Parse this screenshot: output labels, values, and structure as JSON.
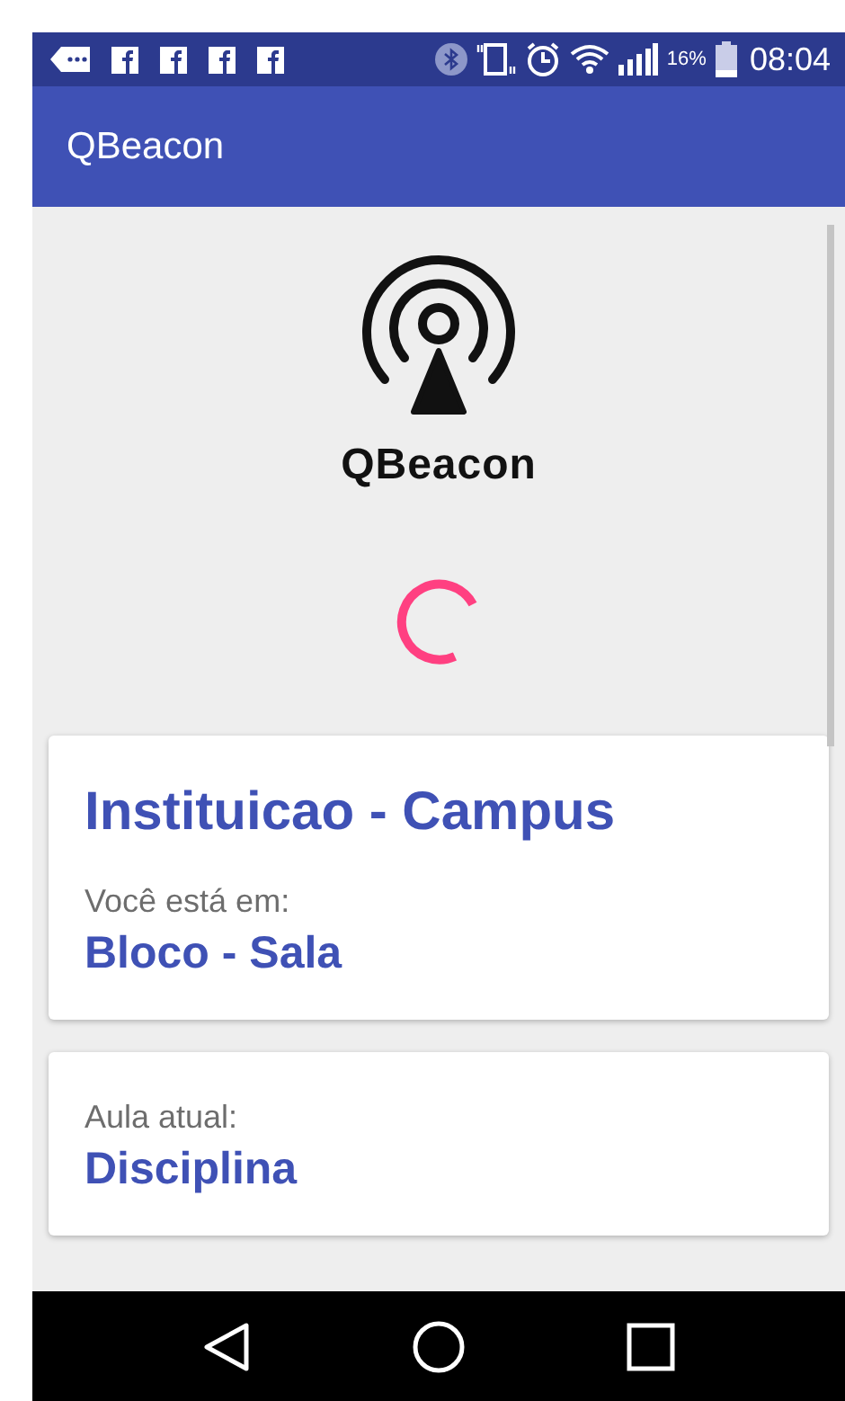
{
  "status_bar": {
    "battery": "16%",
    "time": "08:04"
  },
  "app_bar": {
    "title": "QBeacon"
  },
  "logo": {
    "text": "QBeacon"
  },
  "cards": [
    {
      "title": "Instituicao - Campus",
      "label": "Você está em:",
      "value": "Bloco - Sala"
    },
    {
      "label": "Aula atual:",
      "value": "Disciplina"
    }
  ]
}
